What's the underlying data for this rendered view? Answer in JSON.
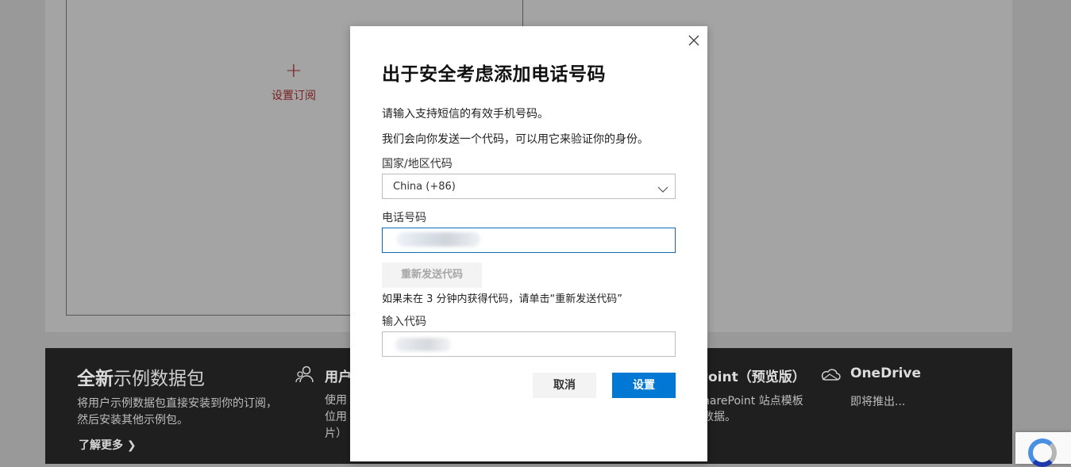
{
  "background": {
    "card": {
      "plus": "+",
      "setup_label": "设置订阅"
    },
    "sample_pack": {
      "title_bold": "全新",
      "title_rest": "示例数据包",
      "description": "将用户示例数据包直接安装到你的订阅，然后安装其他示例包。",
      "learn_more": "了解更多 ❯"
    },
    "users": {
      "title": "用户",
      "description_lines": [
        "使用",
        "位用",
        "片）"
      ]
    },
    "sharepoint": {
      "title": "ePoint（预览版）",
      "description_lines": [
        "harePoint 站点模板",
        "数据。"
      ]
    },
    "onedrive": {
      "title": "OneDrive",
      "description": "即将推出..."
    }
  },
  "dialog": {
    "title": "出于安全考虑添加电话号码",
    "line1": "请输入支持短信的有效手机号码。",
    "line2": "我们会向你发送一个代码，可以用它来验证你的身份。",
    "country_label": "国家/地区代码",
    "country_value": "China (+86)",
    "phone_label": "电话号码",
    "resend_button": "重新发送代码",
    "hint": "如果未在 3 分钟内获得代码，请单击“重新发送代码”",
    "code_label": "输入代码",
    "cancel_button": "取消",
    "submit_button": "设置"
  },
  "colors": {
    "accent": "#0078d4",
    "link_red": "#7a1f1f",
    "overlay": "#999999"
  },
  "icons": [
    "close-icon",
    "chevron-down-icon",
    "users-icon",
    "cloud-icon",
    "recaptcha-icon"
  ]
}
